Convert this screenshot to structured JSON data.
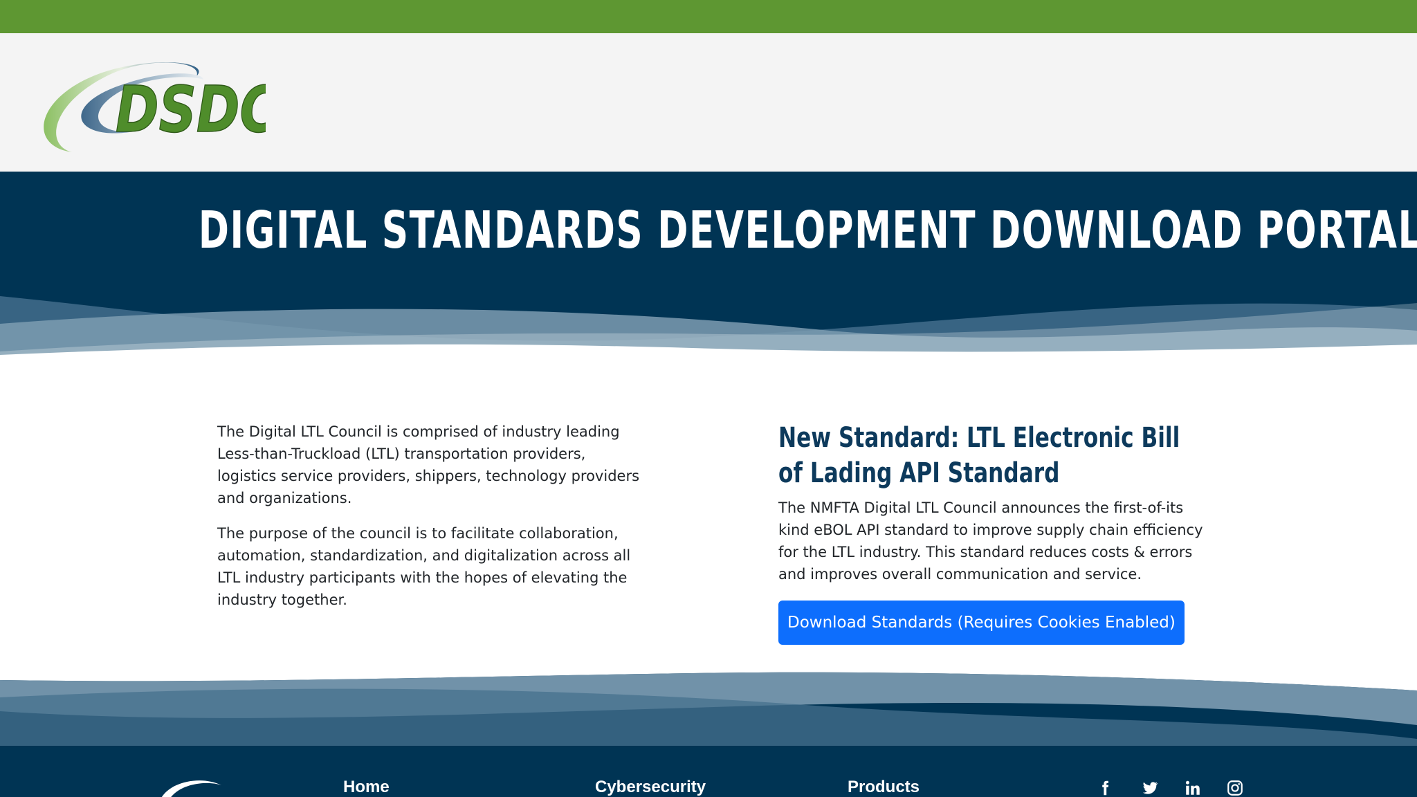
{
  "brand": {
    "logo_text": "DSDC",
    "colors": {
      "green": "#5e9732",
      "navy": "#003454",
      "button": "#0d6efd",
      "heading": "#0d3a5c"
    }
  },
  "hero": {
    "title": "DIGITAL STANDARDS DEVELOPMENT DOWNLOAD PORTAL"
  },
  "intro": {
    "paragraphs": [
      "The Digital LTL Council is comprised of industry leading Less-than-Truckload (LTL) transportation providers, logistics service providers, shippers, technology providers and organizations.",
      "The purpose of the council is to facilitate collaboration, automation, standardization, and digitalization across all LTL industry participants with the hopes of elevating the industry together."
    ]
  },
  "announcement": {
    "title": "New Standard: LTL Electronic Bill of Lading API Standard",
    "body": "The NMFTA Digital LTL Council announces the first-of-its kind eBOL API standard to improve supply chain efficiency for the LTL industry. This standard reduces costs & errors and improves overall communication and service.",
    "button_label": "Download Standards (Requires Cookies Enabled)"
  },
  "footer": {
    "links": [
      "Home",
      "Cybersecurity",
      "Products"
    ],
    "social_icons": [
      "facebook-icon",
      "twitter-icon",
      "linkedin-icon",
      "instagram-icon"
    ]
  }
}
